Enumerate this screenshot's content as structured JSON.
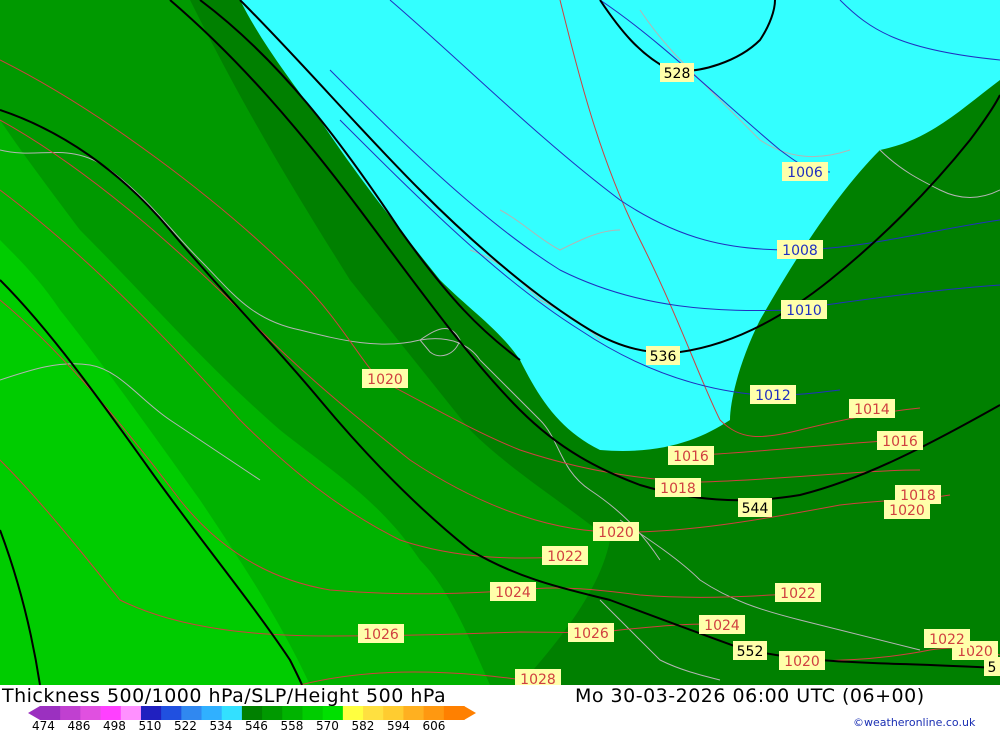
{
  "title": "Thickness 500/1000 hPa/SLP/Height 500 hPa",
  "timestamp": "Mo 30-03-2026 06:00 UTC (06+00)",
  "credit": "©weatheronline.co.uk",
  "colors": {
    "cold_cyan": "#33ffff",
    "green_1": "#008000",
    "green_2": "#009900",
    "green_3": "#00b300",
    "green_4": "#00cc00",
    "slp_red": "#d04040",
    "slp_blue": "#2030c0",
    "height_black": "#000000",
    "coast_gray": "#b4b4b4",
    "label_bg": "#ffffaa"
  },
  "legend": {
    "ticks": [
      "474",
      "486",
      "498",
      "510",
      "522",
      "534",
      "546",
      "558",
      "570",
      "582",
      "594",
      "606"
    ],
    "colors": [
      "#9b30c0",
      "#c040d0",
      "#e050e0",
      "#ff40ff",
      "#ff90ff",
      "#2020c0",
      "#2050e0",
      "#3088f0",
      "#30b0ff",
      "#33e0ff",
      "#008000",
      "#009900",
      "#00b300",
      "#00cc00",
      "#00e000",
      "#ffff40",
      "#ffe040",
      "#ffcc30",
      "#ffb020",
      "#ff9810",
      "#ff8000"
    ]
  },
  "contours": {
    "height_labels": [
      "528",
      "536",
      "544",
      "552",
      "5"
    ],
    "slp_labels": [
      "1006",
      "1008",
      "1010",
      "1012",
      "1014",
      "1016",
      "1016",
      "1018",
      "1018",
      "1020",
      "1020",
      "1020",
      "1020",
      "1020",
      "1022",
      "1022",
      "1022",
      "1024",
      "1024",
      "1026",
      "1026",
      "1028"
    ]
  }
}
